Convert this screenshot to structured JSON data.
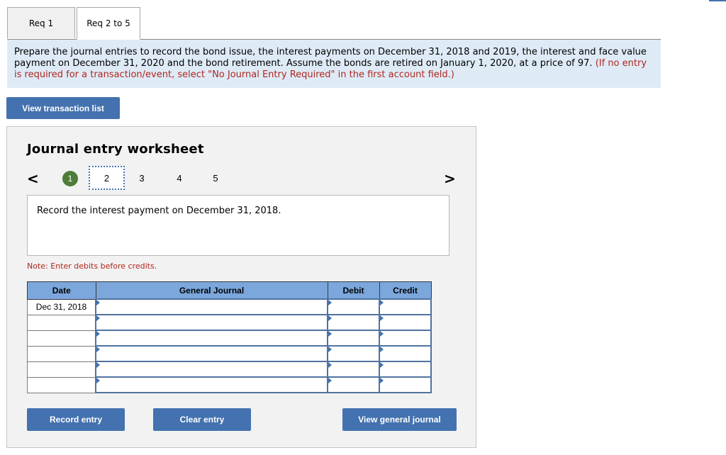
{
  "tabs": [
    {
      "label": "Req 1",
      "active": false
    },
    {
      "label": "Req 2 to 5",
      "active": true
    }
  ],
  "instructions": {
    "text": "Prepare the journal entries to record the bond issue, the interest payments on December 31, 2018 and 2019,  the interest and face value payment on December 31, 2020 and the bond retirement. Assume the bonds are retired on January 1, 2020, at a price of  97.",
    "note": "(If no entry is required for a transaction/event, select \"No Journal Entry Required\" in the first account field.)"
  },
  "buttons": {
    "view_transaction_list": "View transaction list",
    "record_entry": "Record entry",
    "clear_entry": "Clear entry",
    "view_general_journal": "View general journal"
  },
  "worksheet": {
    "title": "Journal entry worksheet",
    "prev_icon": "<",
    "next_icon": ">",
    "steps": [
      "1",
      "2",
      "3",
      "4",
      "5"
    ],
    "completed_step": "1",
    "current_step": "2",
    "description": "Record the interest payment on December 31, 2018.",
    "note": "Note: Enter debits before credits."
  },
  "journal_table": {
    "headers": {
      "date": "Date",
      "general_journal": "General Journal",
      "debit": "Debit",
      "credit": "Credit"
    },
    "rows": [
      {
        "date": "Dec 31, 2018",
        "account": "",
        "debit": "",
        "credit": ""
      },
      {
        "date": "",
        "account": "",
        "debit": "",
        "credit": ""
      },
      {
        "date": "",
        "account": "",
        "debit": "",
        "credit": ""
      },
      {
        "date": "",
        "account": "",
        "debit": "",
        "credit": ""
      },
      {
        "date": "",
        "account": "",
        "debit": "",
        "credit": ""
      },
      {
        "date": "",
        "account": "",
        "debit": "",
        "credit": ""
      }
    ]
  },
  "colors": {
    "accent_blue": "#4472b0",
    "header_blue": "#7ba7dc",
    "instruction_bg": "#deebf7",
    "note_red": "#b0261d",
    "completed_green": "#4e7d3a"
  }
}
